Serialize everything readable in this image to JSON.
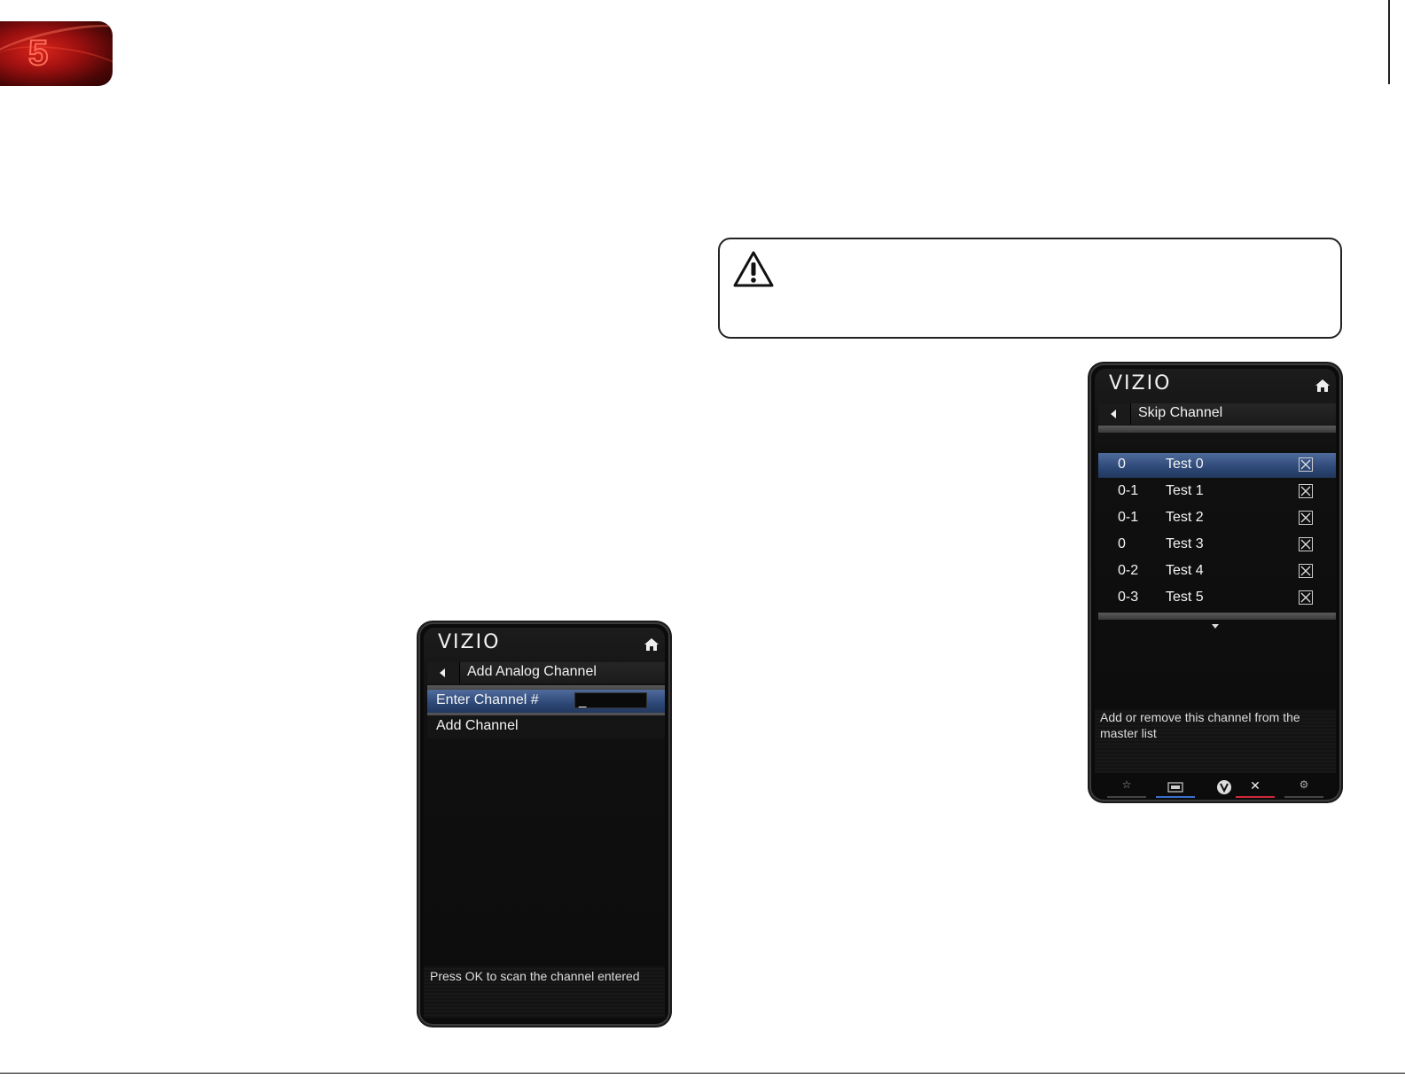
{
  "chapter": {
    "number": "5"
  },
  "add_analog_panel": {
    "logo": "VIZIO",
    "title": "Add Analog Channel",
    "rows": [
      {
        "label": "Enter Channel #",
        "value": "_"
      },
      {
        "label": "Add Channel"
      }
    ],
    "help": "Press OK to scan the channel entered"
  },
  "skip_channel_panel": {
    "logo": "VIZIO",
    "title": "Skip Channel",
    "channels": [
      {
        "number": "0",
        "name": "Test 0",
        "checked": true
      },
      {
        "number": "0-1",
        "name": "Test 1",
        "checked": true
      },
      {
        "number": "0-1",
        "name": "Test 2",
        "checked": true
      },
      {
        "number": "0",
        "name": "Test 3",
        "checked": true
      },
      {
        "number": "0-2",
        "name": "Test 4",
        "checked": true
      },
      {
        "number": "0-3",
        "name": "Test 5",
        "checked": true
      }
    ],
    "help": "Add or remove this channel from the master list",
    "bottom_icons": [
      "star-icon",
      "input-icon",
      "vizio-v-icon",
      "close-icon",
      "gear-icon"
    ],
    "bottom_colors": [
      "#555555",
      "#3a6fd0",
      "#555555",
      "#d02a3a",
      "#555555"
    ]
  },
  "colors": {
    "selection": "#2d4876"
  }
}
